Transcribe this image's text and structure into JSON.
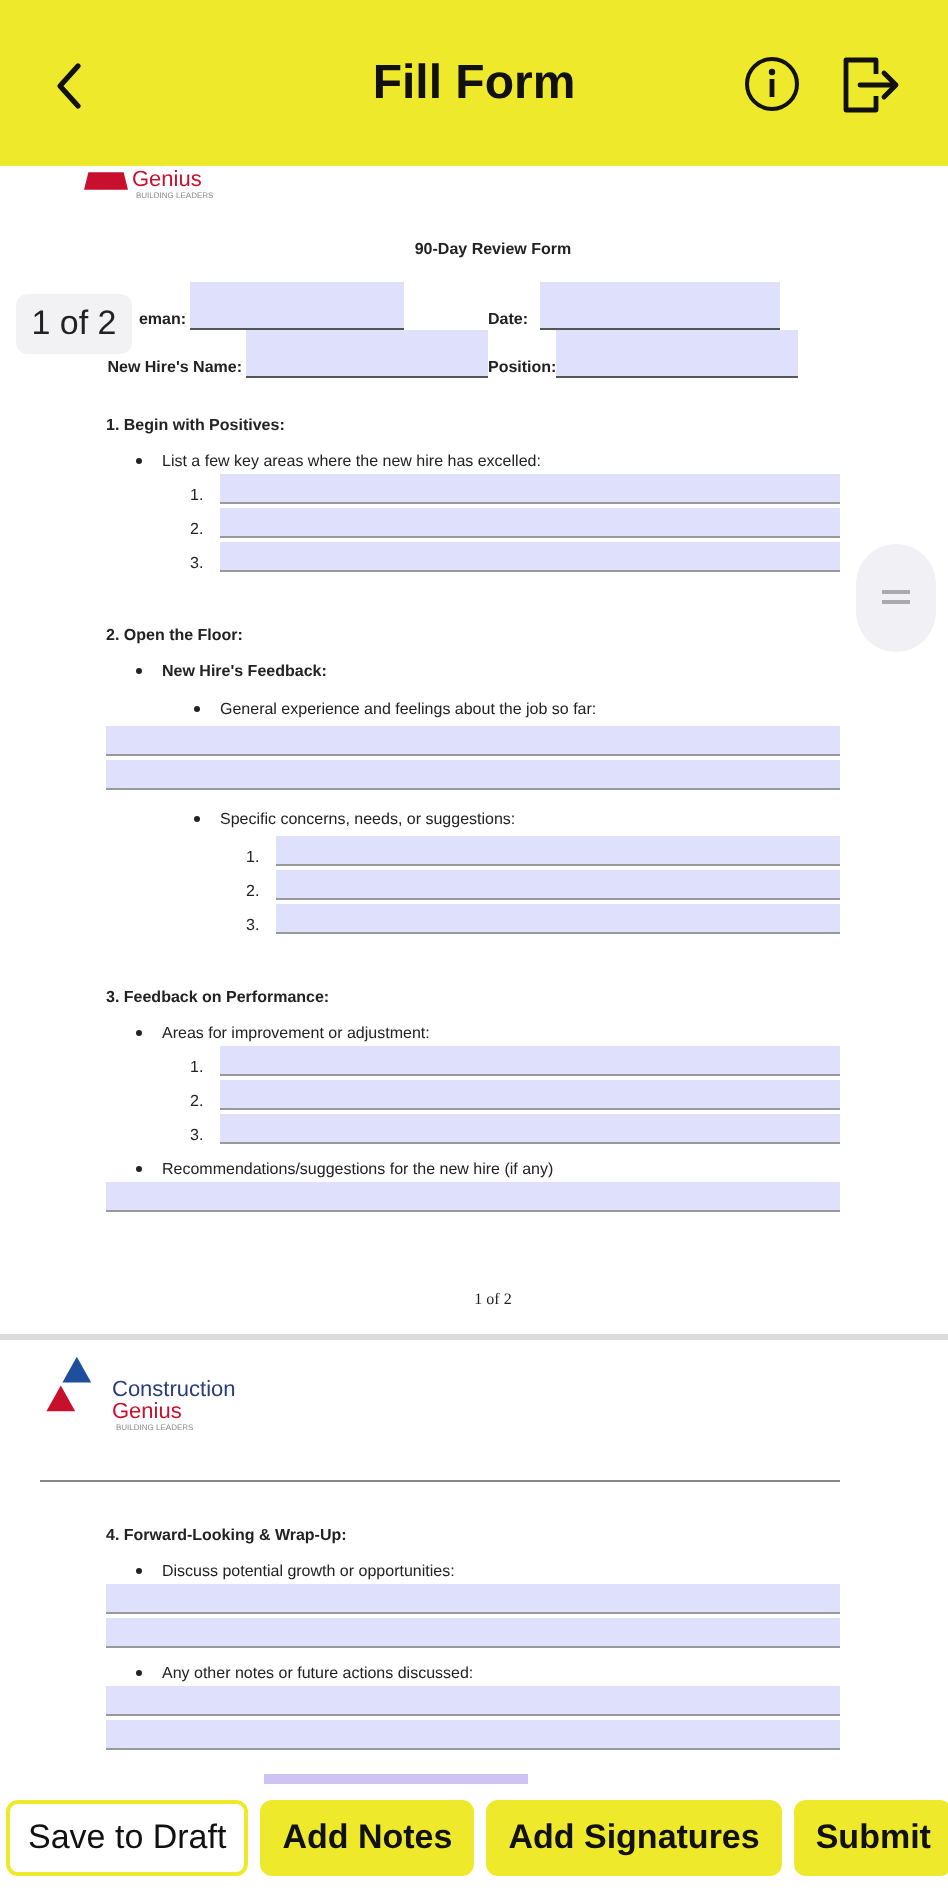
{
  "header": {
    "title": "Fill Form"
  },
  "page_indicator": "1 of 2",
  "pages": [
    {
      "logo": {
        "kind": "partial",
        "lines": [
          "Genius",
          "BUILDING LEADERS"
        ]
      },
      "title": "90-Day Review Form",
      "field_rows": [
        [
          {
            "label": "eman:"
          },
          {
            "label": "Date:"
          }
        ],
        [
          {
            "label": "New Hire's Name:"
          },
          {
            "label": "Position:"
          }
        ]
      ],
      "blocks": [
        {
          "kind": "heading",
          "text": "1. Begin with Positives:"
        },
        {
          "kind": "bullet",
          "text": "List a few key areas where the new hire has excelled:",
          "bold": false,
          "children": [
            {
              "kind": "numbered_field",
              "number": "1."
            },
            {
              "kind": "numbered_field",
              "number": "2."
            },
            {
              "kind": "numbered_field",
              "number": "3."
            }
          ]
        },
        {
          "kind": "heading",
          "text": "2. Open the Floor:"
        },
        {
          "kind": "bullet",
          "text": "New Hire's Feedback:",
          "bold": true,
          "children": [
            {
              "kind": "bullet",
              "text": "General experience and feelings about the job so far:",
              "bold": false,
              "children": [
                {
                  "kind": "field"
                },
                {
                  "kind": "field"
                }
              ]
            },
            {
              "kind": "bullet",
              "text": "Specific concerns, needs, or suggestions:",
              "bold": false,
              "children": [
                {
                  "kind": "numbered_field",
                  "number": "1."
                },
                {
                  "kind": "numbered_field",
                  "number": "2."
                },
                {
                  "kind": "numbered_field",
                  "number": "3."
                }
              ]
            }
          ]
        },
        {
          "kind": "heading",
          "text": "3. Feedback on Performance:"
        },
        {
          "kind": "bullet",
          "text": "Areas for improvement or adjustment:",
          "bold": false,
          "children": [
            {
              "kind": "numbered_field",
              "number": "1."
            },
            {
              "kind": "numbered_field",
              "number": "2."
            },
            {
              "kind": "numbered_field",
              "number": "3."
            }
          ]
        },
        {
          "kind": "bullet",
          "text": "Recommendations/suggestions for the new hire (if any)",
          "bold": false,
          "children": [
            {
              "kind": "field"
            }
          ]
        }
      ],
      "footer": "1 of 2"
    },
    {
      "logo": {
        "kind": "full",
        "lines": [
          "Construction",
          "Genius",
          "BUILDING LEADERS"
        ]
      },
      "blocks": [
        {
          "kind": "heading",
          "text": "4. Forward-Looking & Wrap-Up:"
        },
        {
          "kind": "bullet",
          "text": "Discuss potential growth or opportunities:",
          "bold": false,
          "children": [
            {
              "kind": "field"
            },
            {
              "kind": "field"
            }
          ]
        },
        {
          "kind": "bullet",
          "text": "Any other notes or future actions discussed:",
          "bold": false,
          "children": [
            {
              "kind": "field"
            },
            {
              "kind": "field"
            }
          ]
        },
        {
          "kind": "bar"
        }
      ]
    }
  ],
  "buttons": [
    {
      "label": "Save to Draft",
      "kind": "outline"
    },
    {
      "label": "Add Notes",
      "kind": "filled"
    },
    {
      "label": "Add Signatures",
      "kind": "filled"
    },
    {
      "label": "Submit",
      "kind": "filled"
    }
  ]
}
